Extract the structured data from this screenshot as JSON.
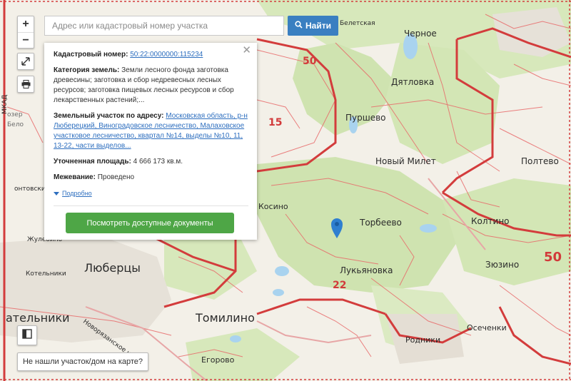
{
  "search": {
    "placeholder": "Адрес или кадастровый номер участка",
    "button_label": "Найти",
    "button_icon": "search-icon"
  },
  "map_controls": {
    "zoom_in": "+",
    "zoom_out": "−",
    "fullscreen_icon": "expand-icon",
    "print_icon": "printer-icon",
    "layers_icon": "layers-icon"
  },
  "info_panel": {
    "cadastral_label": "Кадастровый номер:",
    "cadastral_number": "50:22:0000000:115234",
    "category_label": "Категория земель:",
    "category_text": "Земли лесного фонда заготовка древесины; заготовка и сбор недревесных лесных ресурсов; заготовка пищевых лесных ресурсов и сбор лекарственных растений;...",
    "address_label": "Земельный участок по адресу:",
    "address_text": "Московская область, р-н Люберецкий, Виноградовское лесничество, Малаховское участковое лесничество, квартал №14, выделы №10, 11, 13-22, части выделов...",
    "area_label": "Уточненная площадь:",
    "area_value": "4 666 173 кв.м.",
    "survey_label": "Межевание:",
    "survey_value": "Проведено",
    "more_label": "Подробно",
    "documents_button": "Посмотреть доступные документы"
  },
  "not_found_button": "Не нашли участок/дом на карте?",
  "map_labels": {
    "lyubertsy": "Люберцы",
    "tomilino": "Томилино",
    "kotelniki_big": "ательники",
    "kotelniki_metro": "Котельники",
    "zhulebino": "Жулебино",
    "lermontovsky": "онтовский",
    "kosino": "Косино",
    "egorovo": "Егорово",
    "torbeevo": "Торбеево",
    "lukyanovka": "Лукьяновка",
    "koltsino": "Колтино",
    "zyuzino": "Зюзино",
    "oseчenki": "Осеченки",
    "rodniki": "Родники",
    "chernoe": "Черное",
    "dyatlovka": "Дятловка",
    "pyrsheevo": "Пуршево",
    "noviy_milet": "Новый Милет",
    "poltevo": "Полтево",
    "beletskaya": "Белетская",
    "novoryazanskoe": "Новорязанское ш.",
    "mkad": "МКАД",
    "ozero": "озер",
    "belo": "Бело",
    "road_50_top": "50",
    "road_15": "15",
    "road_50_right": "50",
    "road_22": "22"
  },
  "colors": {
    "forest": "#cfe3b0",
    "boundary": "#d33c3c",
    "parcel_line": "#e86a6a",
    "button_blue": "#3a7fc1",
    "button_green": "#4ea646",
    "marker": "#2f7fd0",
    "water": "#a9d3ef"
  }
}
